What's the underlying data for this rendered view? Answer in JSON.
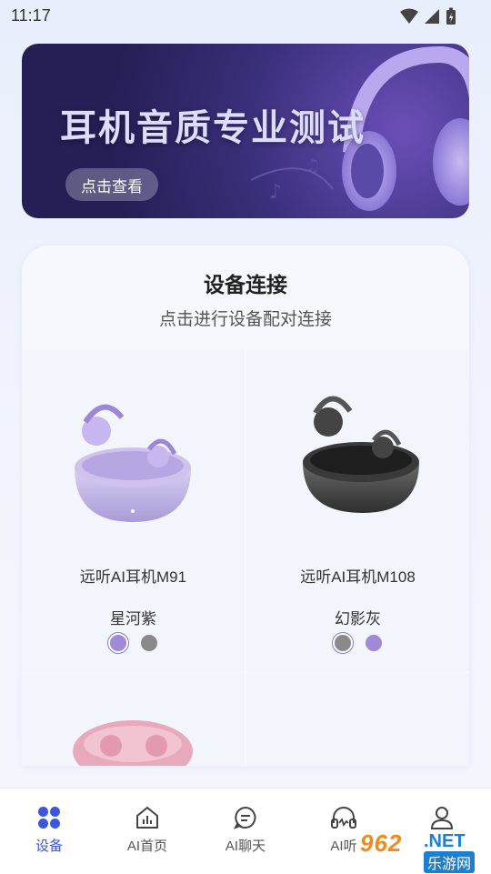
{
  "status_bar": {
    "time": "11:17"
  },
  "banner": {
    "title": "耳机音质专业测试",
    "button_label": "点击查看"
  },
  "device_section": {
    "title": "设备连接",
    "subtitle": "点击进行设备配对连接",
    "products": [
      {
        "name": "远听AI耳机M91",
        "color_name": "星河紫",
        "swatches": [
          {
            "color": "#a08ad8",
            "selected": true
          },
          {
            "color": "#8a8a8a",
            "selected": false
          }
        ]
      },
      {
        "name": "远听AI耳机M108",
        "color_name": "幻影灰",
        "swatches": [
          {
            "color": "#8a8a8a",
            "selected": true
          },
          {
            "color": "#a08ad8",
            "selected": false
          }
        ]
      }
    ]
  },
  "tabbar": {
    "tabs": [
      {
        "label": "设备",
        "icon": "four-dots-icon",
        "active": true
      },
      {
        "label": "AI首页",
        "icon": "home-chart-icon",
        "active": false
      },
      {
        "label": "AI聊天",
        "icon": "chat-bubble-icon",
        "active": false
      },
      {
        "label": "AI听",
        "icon": "headphones-icon",
        "active": false
      },
      {
        "label": "",
        "icon": "user-icon",
        "active": false
      }
    ]
  },
  "watermark": {
    "number": "962",
    "net": ".NET",
    "cn": "乐游网"
  },
  "colors": {
    "accent": "#3b57e0",
    "purple_swatch": "#a08ad8",
    "gray_swatch": "#8a8a8a"
  }
}
